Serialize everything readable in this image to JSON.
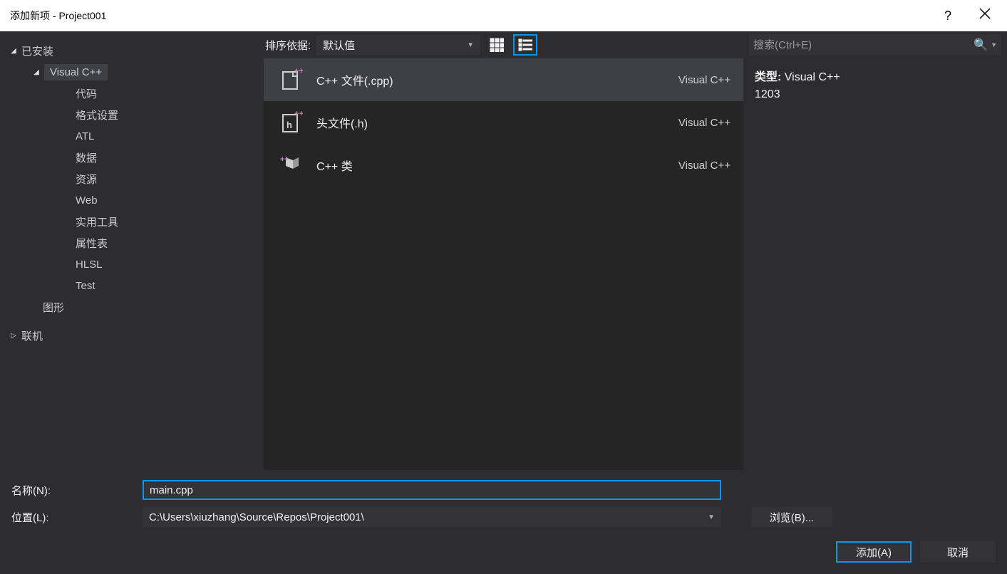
{
  "title": "添加新项 - Project001",
  "sidebar": {
    "installed": "已安装",
    "visualcpp": "Visual C++",
    "sub": {
      "code": "代码",
      "format": "格式设置",
      "atl": "ATL",
      "data": "数据",
      "resource": "资源",
      "web": "Web",
      "util": "实用工具",
      "prop": "属性表",
      "hlsl": "HLSL",
      "test": "Test"
    },
    "graphics": "图形",
    "online": "联机"
  },
  "toolbar": {
    "sort_label": "排序依据:",
    "sort_value": "默认值"
  },
  "templates": [
    {
      "name": "C++ 文件(.cpp)",
      "lang": "Visual C++"
    },
    {
      "name": "头文件(.h)",
      "lang": "Visual C++"
    },
    {
      "name": "C++ 类",
      "lang": "Visual C++"
    }
  ],
  "search": {
    "placeholder": "搜索(Ctrl+E)"
  },
  "details": {
    "type_label": "类型:",
    "type_value": "Visual C++",
    "desc": "1203"
  },
  "form": {
    "name_label": "名称(N):",
    "name_value": "main.cpp",
    "location_label": "位置(L):",
    "location_value": "C:\\Users\\xiuzhang\\Source\\Repos\\Project001\\",
    "browse": "浏览(B)..."
  },
  "buttons": {
    "add": "添加(A)",
    "cancel": "取消"
  }
}
